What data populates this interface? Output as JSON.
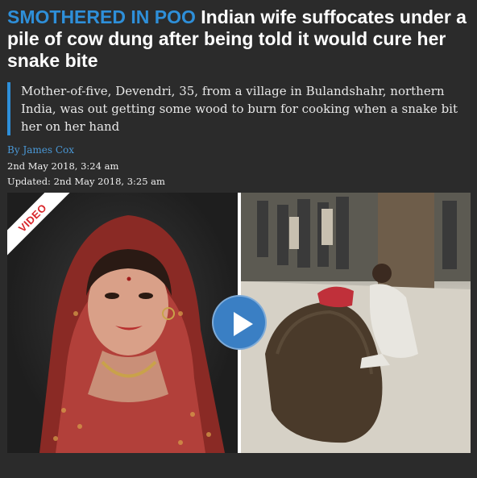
{
  "headline": {
    "kicker": "SMOTHERED IN POO",
    "title": "Indian wife suffocates under a pile of cow dung after being told it would cure her snake bite"
  },
  "standfirst": "Mother-of-five, Devendri, 35, from a village in Bulandshahr, northern India, was out getting some wood to burn for cooking when a snake bit her on her hand",
  "byline": {
    "prefix": "By",
    "author": "James Cox"
  },
  "dates": {
    "published": "2nd May 2018, 3:24 am",
    "updated": "Updated: 2nd May 2018, 3:25 am"
  },
  "media": {
    "badge": "VIDEO",
    "play_icon": "play-icon",
    "colors": {
      "accent": "#2e8fd9",
      "badge_text": "#d9262b",
      "play_button": "#3a7fc4"
    }
  }
}
